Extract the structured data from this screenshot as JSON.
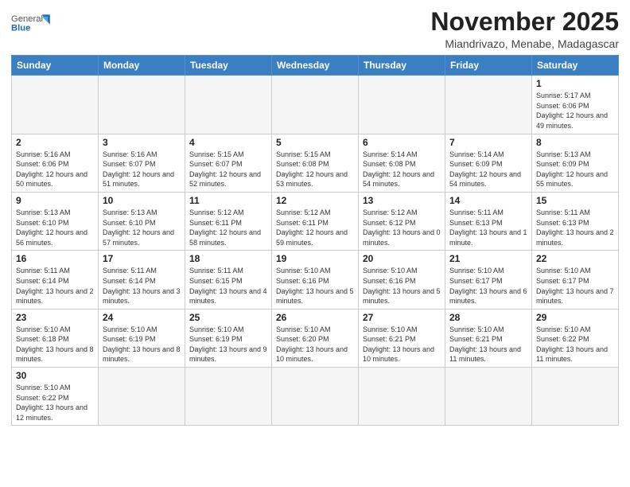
{
  "logo": {
    "general": "General",
    "blue": "Blue"
  },
  "title": "November 2025",
  "location": "Miandrivazo, Menabe, Madagascar",
  "weekdays": [
    "Sunday",
    "Monday",
    "Tuesday",
    "Wednesday",
    "Thursday",
    "Friday",
    "Saturday"
  ],
  "weeks": [
    [
      {
        "day": "",
        "info": ""
      },
      {
        "day": "",
        "info": ""
      },
      {
        "day": "",
        "info": ""
      },
      {
        "day": "",
        "info": ""
      },
      {
        "day": "",
        "info": ""
      },
      {
        "day": "",
        "info": ""
      },
      {
        "day": "1",
        "info": "Sunrise: 5:17 AM\nSunset: 6:06 PM\nDaylight: 12 hours and 49 minutes."
      }
    ],
    [
      {
        "day": "2",
        "info": "Sunrise: 5:16 AM\nSunset: 6:06 PM\nDaylight: 12 hours and 50 minutes."
      },
      {
        "day": "3",
        "info": "Sunrise: 5:16 AM\nSunset: 6:07 PM\nDaylight: 12 hours and 51 minutes."
      },
      {
        "day": "4",
        "info": "Sunrise: 5:15 AM\nSunset: 6:07 PM\nDaylight: 12 hours and 52 minutes."
      },
      {
        "day": "5",
        "info": "Sunrise: 5:15 AM\nSunset: 6:08 PM\nDaylight: 12 hours and 53 minutes."
      },
      {
        "day": "6",
        "info": "Sunrise: 5:14 AM\nSunset: 6:08 PM\nDaylight: 12 hours and 54 minutes."
      },
      {
        "day": "7",
        "info": "Sunrise: 5:14 AM\nSunset: 6:09 PM\nDaylight: 12 hours and 54 minutes."
      },
      {
        "day": "8",
        "info": "Sunrise: 5:13 AM\nSunset: 6:09 PM\nDaylight: 12 hours and 55 minutes."
      }
    ],
    [
      {
        "day": "9",
        "info": "Sunrise: 5:13 AM\nSunset: 6:10 PM\nDaylight: 12 hours and 56 minutes."
      },
      {
        "day": "10",
        "info": "Sunrise: 5:13 AM\nSunset: 6:10 PM\nDaylight: 12 hours and 57 minutes."
      },
      {
        "day": "11",
        "info": "Sunrise: 5:12 AM\nSunset: 6:11 PM\nDaylight: 12 hours and 58 minutes."
      },
      {
        "day": "12",
        "info": "Sunrise: 5:12 AM\nSunset: 6:11 PM\nDaylight: 12 hours and 59 minutes."
      },
      {
        "day": "13",
        "info": "Sunrise: 5:12 AM\nSunset: 6:12 PM\nDaylight: 13 hours and 0 minutes."
      },
      {
        "day": "14",
        "info": "Sunrise: 5:11 AM\nSunset: 6:13 PM\nDaylight: 13 hours and 1 minute."
      },
      {
        "day": "15",
        "info": "Sunrise: 5:11 AM\nSunset: 6:13 PM\nDaylight: 13 hours and 2 minutes."
      }
    ],
    [
      {
        "day": "16",
        "info": "Sunrise: 5:11 AM\nSunset: 6:14 PM\nDaylight: 13 hours and 2 minutes."
      },
      {
        "day": "17",
        "info": "Sunrise: 5:11 AM\nSunset: 6:14 PM\nDaylight: 13 hours and 3 minutes."
      },
      {
        "day": "18",
        "info": "Sunrise: 5:11 AM\nSunset: 6:15 PM\nDaylight: 13 hours and 4 minutes."
      },
      {
        "day": "19",
        "info": "Sunrise: 5:10 AM\nSunset: 6:16 PM\nDaylight: 13 hours and 5 minutes."
      },
      {
        "day": "20",
        "info": "Sunrise: 5:10 AM\nSunset: 6:16 PM\nDaylight: 13 hours and 5 minutes."
      },
      {
        "day": "21",
        "info": "Sunrise: 5:10 AM\nSunset: 6:17 PM\nDaylight: 13 hours and 6 minutes."
      },
      {
        "day": "22",
        "info": "Sunrise: 5:10 AM\nSunset: 6:17 PM\nDaylight: 13 hours and 7 minutes."
      }
    ],
    [
      {
        "day": "23",
        "info": "Sunrise: 5:10 AM\nSunset: 6:18 PM\nDaylight: 13 hours and 8 minutes."
      },
      {
        "day": "24",
        "info": "Sunrise: 5:10 AM\nSunset: 6:19 PM\nDaylight: 13 hours and 8 minutes."
      },
      {
        "day": "25",
        "info": "Sunrise: 5:10 AM\nSunset: 6:19 PM\nDaylight: 13 hours and 9 minutes."
      },
      {
        "day": "26",
        "info": "Sunrise: 5:10 AM\nSunset: 6:20 PM\nDaylight: 13 hours and 10 minutes."
      },
      {
        "day": "27",
        "info": "Sunrise: 5:10 AM\nSunset: 6:21 PM\nDaylight: 13 hours and 10 minutes."
      },
      {
        "day": "28",
        "info": "Sunrise: 5:10 AM\nSunset: 6:21 PM\nDaylight: 13 hours and 11 minutes."
      },
      {
        "day": "29",
        "info": "Sunrise: 5:10 AM\nSunset: 6:22 PM\nDaylight: 13 hours and 11 minutes."
      }
    ],
    [
      {
        "day": "30",
        "info": "Sunrise: 5:10 AM\nSunset: 6:22 PM\nDaylight: 13 hours and 12 minutes."
      },
      {
        "day": "",
        "info": ""
      },
      {
        "day": "",
        "info": ""
      },
      {
        "day": "",
        "info": ""
      },
      {
        "day": "",
        "info": ""
      },
      {
        "day": "",
        "info": ""
      },
      {
        "day": "",
        "info": ""
      }
    ]
  ]
}
